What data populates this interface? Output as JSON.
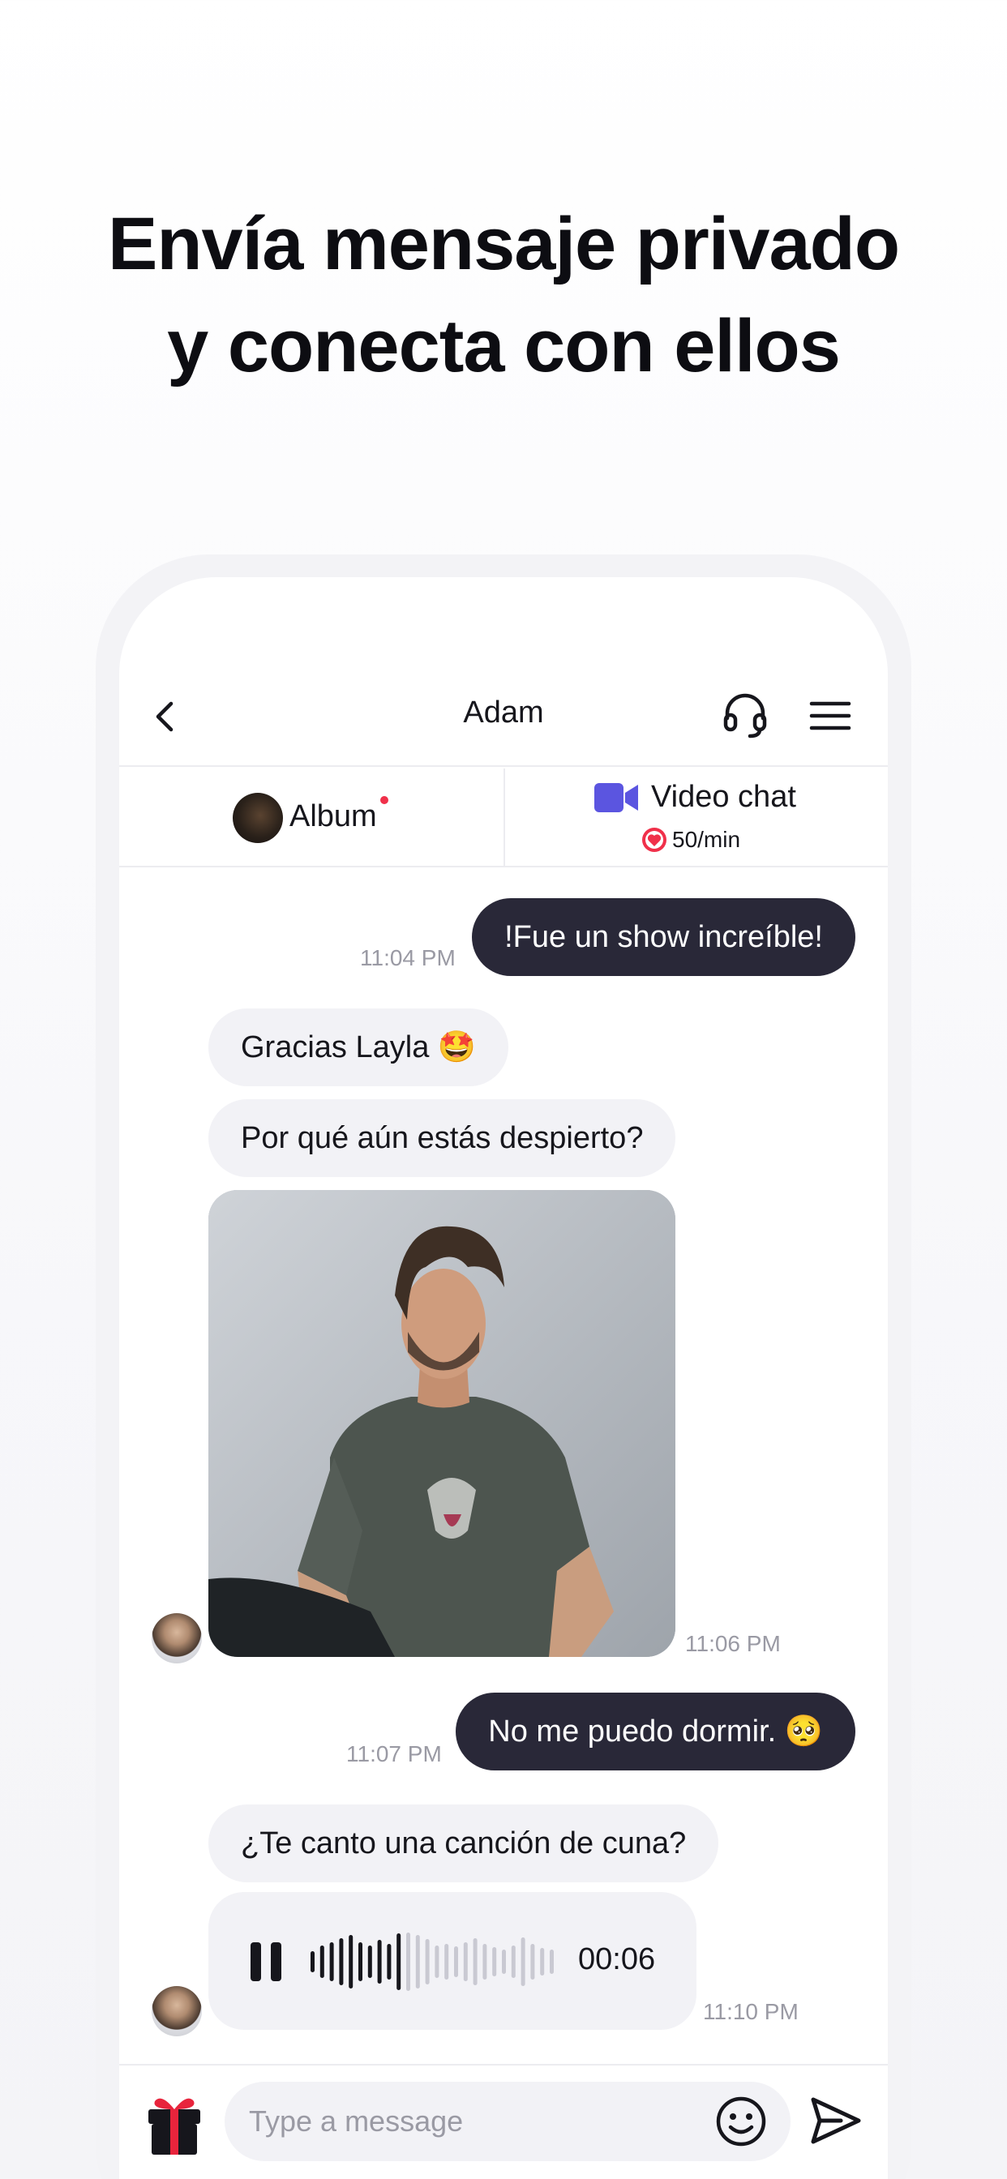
{
  "headline": {
    "line1": "Envía mensaje privado",
    "line2": "y conecta con ellos"
  },
  "nav": {
    "title": "Adam",
    "back_icon": "chevron-left-icon",
    "support_icon": "headset-icon",
    "menu_icon": "hamburger-icon"
  },
  "tabs": {
    "album_label": "Album",
    "video_label": "Video chat",
    "video_price": "50/min"
  },
  "messages": [
    {
      "direction": "out",
      "text": "!Fue un show increíble!",
      "time": "11:04 PM"
    },
    {
      "direction": "in",
      "text": "Gracias Layla 🤩"
    },
    {
      "direction": "in",
      "text": "Por qué aún estás despierto?"
    },
    {
      "direction": "in",
      "type": "photo",
      "time": "11:06 PM"
    },
    {
      "direction": "out",
      "text": "No me puedo dormir. 🥺",
      "time": "11:07 PM"
    },
    {
      "direction": "in",
      "text": "¿Te canto una canción de cuna?"
    },
    {
      "direction": "in",
      "type": "voice",
      "duration": "00:06",
      "time": "11:10 PM"
    }
  ],
  "composer": {
    "placeholder": "Type a message",
    "gift_icon": "gift-icon",
    "emoji_icon": "smiley-icon",
    "send_icon": "send-icon"
  },
  "colors": {
    "outgoing_bubble": "#292838",
    "incoming_bubble": "#f2f2f6",
    "video_icon": "#5b55e0",
    "heart": "#f0304a"
  }
}
